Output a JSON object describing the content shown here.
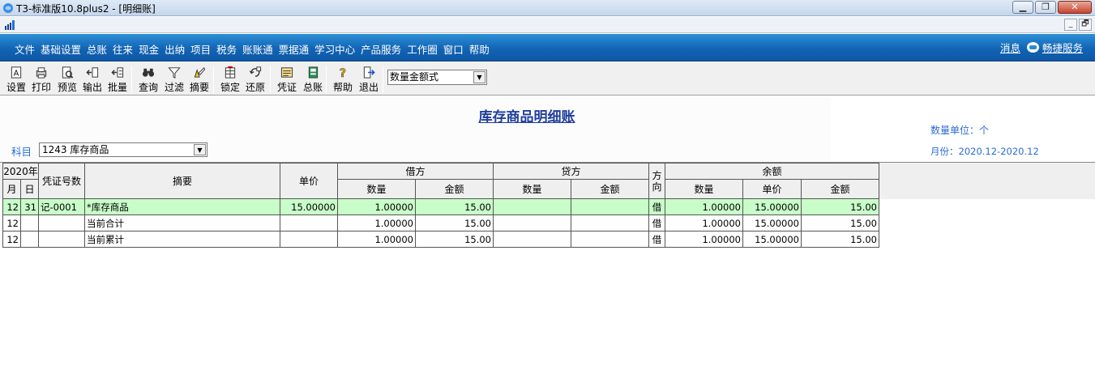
{
  "window": {
    "title": "T3-标准版10.8plus2 - [明细账]"
  },
  "mdi": {
    "minimize_label": "_",
    "restore_label": "🗗"
  },
  "menu": {
    "items": [
      "文件",
      "基础设置",
      "总账",
      "往来",
      "现金",
      "出纳",
      "项目",
      "税务",
      "账账通",
      "票据通",
      "学习中心",
      "产品服务",
      "工作圈",
      "窗口",
      "帮助"
    ],
    "message_label": "消息",
    "service_label": "畅捷服务"
  },
  "toolbar": {
    "buttons": [
      {
        "label": "设置",
        "icon": "settings-icon"
      },
      {
        "label": "打印",
        "icon": "printer-icon"
      },
      {
        "label": "预览",
        "icon": "preview-icon"
      },
      {
        "label": "输出",
        "icon": "export-icon"
      },
      {
        "label": "批量",
        "icon": "batch-icon"
      },
      {
        "label": "查询",
        "icon": "binoculars-icon"
      },
      {
        "label": "过滤",
        "icon": "filter-icon"
      },
      {
        "label": "摘要",
        "icon": "summary-icon"
      },
      {
        "label": "锁定",
        "icon": "lock-icon"
      },
      {
        "label": "还原",
        "icon": "restore-icon"
      },
      {
        "label": "凭证",
        "icon": "voucher-icon"
      },
      {
        "label": "总账",
        "icon": "ledger-icon"
      },
      {
        "label": "帮助",
        "icon": "help-icon"
      },
      {
        "label": "退出",
        "icon": "exit-icon"
      }
    ],
    "format_select": "数量金额式"
  },
  "header": {
    "title": "库存商品明细账",
    "unit": "数量单位：个",
    "month": "月份：2020.12-2020.12",
    "subject_label": "科目",
    "subject_value": "1243 库存商品"
  },
  "table": {
    "year": "2020年",
    "col_month": "月",
    "col_day": "日",
    "col_voucher": "凭证号数",
    "col_summary": "摘要",
    "col_price": "单价",
    "col_debit": "借方",
    "col_credit": "贷方",
    "col_dir": "方向",
    "col_balance": "余额",
    "col_qty": "数量",
    "col_amt": "金额",
    "col_unitprice": "单价",
    "rows": [
      {
        "month": "12",
        "day": "31",
        "voucher": "记-0001",
        "summary": "*库存商品",
        "price": "15.00000",
        "debit_qty": "1.00000",
        "debit_amt": "15.00",
        "credit_qty": "",
        "credit_amt": "",
        "dir": "借",
        "bal_qty": "1.00000",
        "bal_price": "15.00000",
        "bal_amt": "15.00"
      },
      {
        "month": "12",
        "day": "",
        "voucher": "",
        "summary": "当前合计",
        "price": "",
        "debit_qty": "1.00000",
        "debit_amt": "15.00",
        "credit_qty": "",
        "credit_amt": "",
        "dir": "借",
        "bal_qty": "1.00000",
        "bal_price": "15.00000",
        "bal_amt": "15.00"
      },
      {
        "month": "12",
        "day": "",
        "voucher": "",
        "summary": "当前累计",
        "price": "",
        "debit_qty": "1.00000",
        "debit_amt": "15.00",
        "credit_qty": "",
        "credit_amt": "",
        "dir": "借",
        "bal_qty": "1.00000",
        "bal_price": "15.00000",
        "bal_amt": "15.00"
      }
    ]
  }
}
